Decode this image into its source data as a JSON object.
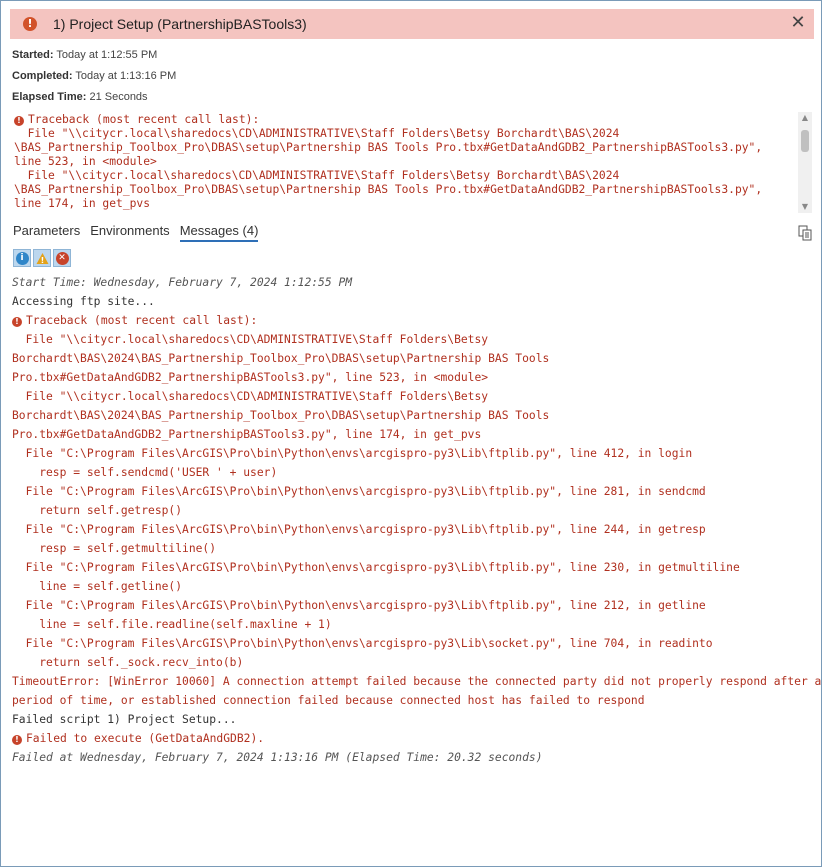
{
  "header": {
    "title": "1) Project Setup (PartnershipBASTools3)",
    "status_icon": "error-icon",
    "close_glyph": "✕"
  },
  "meta": {
    "started_label": "Started:",
    "started_value": "Today at 1:12:55 PM",
    "completed_label": "Completed:",
    "completed_value": "Today at 1:13:16 PM",
    "elapsed_label": "Elapsed Time:",
    "elapsed_value": "21 Seconds"
  },
  "traceback_box": {
    "lines": [
      "Traceback (most recent call last):",
      "  File \"\\\\citycr.local\\sharedocs\\CD\\ADMINISTRATIVE\\Staff Folders\\Betsy Borchardt\\BAS\\2024",
      "\\BAS_Partnership_Toolbox_Pro\\DBAS\\setup\\Partnership BAS Tools Pro.tbx#GetDataAndGDB2_PartnershipBASTools3.py\",",
      "line 523, in <module>",
      "  File \"\\\\citycr.local\\sharedocs\\CD\\ADMINISTRATIVE\\Staff Folders\\Betsy Borchardt\\BAS\\2024",
      "\\BAS_Partnership_Toolbox_Pro\\DBAS\\setup\\Partnership BAS Tools Pro.tbx#GetDataAndGDB2_PartnershipBASTools3.py\",",
      "line 174, in get_pvs"
    ]
  },
  "tabs": [
    {
      "label": "Parameters",
      "active": false
    },
    {
      "label": "Environments",
      "active": false
    },
    {
      "label": "Messages (4)",
      "active": true
    }
  ],
  "filters": [
    {
      "name": "info-filter",
      "glyph": "i",
      "color": "#2f86c9"
    },
    {
      "name": "warning-filter",
      "glyph": "!",
      "color": "#e3a21a"
    },
    {
      "name": "error-filter",
      "glyph": "✕",
      "color": "#c7432a"
    }
  ],
  "messages": [
    {
      "type": "info",
      "text": "Start Time: Wednesday, February 7, 2024 1:12:55 PM"
    },
    {
      "type": "plain",
      "text": "Accessing ftp site..."
    },
    {
      "type": "err-head",
      "text": "Traceback (most recent call last):"
    },
    {
      "type": "err",
      "text": "  File \"\\\\citycr.local\\sharedocs\\CD\\ADMINISTRATIVE\\Staff Folders\\Betsy"
    },
    {
      "type": "err",
      "text": "Borchardt\\BAS\\2024\\BAS_Partnership_Toolbox_Pro\\DBAS\\setup\\Partnership BAS Tools"
    },
    {
      "type": "err",
      "text": "Pro.tbx#GetDataAndGDB2_PartnershipBASTools3.py\", line 523, in <module>"
    },
    {
      "type": "err",
      "text": "  File \"\\\\citycr.local\\sharedocs\\CD\\ADMINISTRATIVE\\Staff Folders\\Betsy"
    },
    {
      "type": "err",
      "text": "Borchardt\\BAS\\2024\\BAS_Partnership_Toolbox_Pro\\DBAS\\setup\\Partnership BAS Tools"
    },
    {
      "type": "err",
      "text": "Pro.tbx#GetDataAndGDB2_PartnershipBASTools3.py\", line 174, in get_pvs"
    },
    {
      "type": "err",
      "text": "  File \"C:\\Program Files\\ArcGIS\\Pro\\bin\\Python\\envs\\arcgispro-py3\\Lib\\ftplib.py\", line 412, in login"
    },
    {
      "type": "err",
      "text": "    resp = self.sendcmd('USER ' + user)"
    },
    {
      "type": "err",
      "text": "  File \"C:\\Program Files\\ArcGIS\\Pro\\bin\\Python\\envs\\arcgispro-py3\\Lib\\ftplib.py\", line 281, in sendcmd"
    },
    {
      "type": "err",
      "text": "    return self.getresp()"
    },
    {
      "type": "err",
      "text": "  File \"C:\\Program Files\\ArcGIS\\Pro\\bin\\Python\\envs\\arcgispro-py3\\Lib\\ftplib.py\", line 244, in getresp"
    },
    {
      "type": "err",
      "text": "    resp = self.getmultiline()"
    },
    {
      "type": "err",
      "text": "  File \"C:\\Program Files\\ArcGIS\\Pro\\bin\\Python\\envs\\arcgispro-py3\\Lib\\ftplib.py\", line 230, in getmultiline"
    },
    {
      "type": "err",
      "text": "    line = self.getline()"
    },
    {
      "type": "err",
      "text": "  File \"C:\\Program Files\\ArcGIS\\Pro\\bin\\Python\\envs\\arcgispro-py3\\Lib\\ftplib.py\", line 212, in getline"
    },
    {
      "type": "err",
      "text": "    line = self.file.readline(self.maxline + 1)"
    },
    {
      "type": "err",
      "text": "  File \"C:\\Program Files\\ArcGIS\\Pro\\bin\\Python\\envs\\arcgispro-py3\\Lib\\socket.py\", line 704, in readinto"
    },
    {
      "type": "err",
      "text": "    return self._sock.recv_into(b)"
    },
    {
      "type": "err",
      "text": "TimeoutError: [WinError 10060] A connection attempt failed because the connected party did not properly respond after a"
    },
    {
      "type": "err",
      "text": "period of time, or established connection failed because connected host has failed to respond"
    },
    {
      "type": "plain",
      "text": "Failed script 1) Project Setup..."
    },
    {
      "type": "err-head",
      "text": "Failed to execute (GetDataAndGDB2)."
    },
    {
      "type": "info",
      "text": "Failed at Wednesday, February 7, 2024 1:13:16 PM (Elapsed Time: 20.32 seconds)"
    }
  ]
}
